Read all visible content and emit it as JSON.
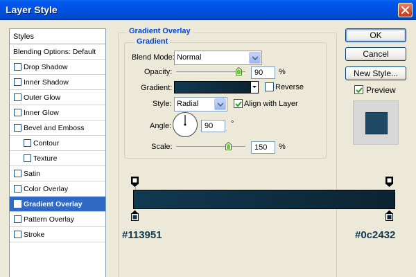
{
  "window": {
    "title": "Layer Style"
  },
  "styles_panel": {
    "header": "Styles",
    "blending_options": "Blending Options: Default",
    "items": [
      {
        "label": "Drop Shadow",
        "checked": false,
        "indent": false,
        "selected": false
      },
      {
        "label": "Inner Shadow",
        "checked": false,
        "indent": false,
        "selected": false
      },
      {
        "label": "Outer Glow",
        "checked": false,
        "indent": false,
        "selected": false
      },
      {
        "label": "Inner Glow",
        "checked": false,
        "indent": false,
        "selected": false
      },
      {
        "label": "Bevel and Emboss",
        "checked": false,
        "indent": false,
        "selected": false
      },
      {
        "label": "Contour",
        "checked": false,
        "indent": true,
        "selected": false
      },
      {
        "label": "Texture",
        "checked": false,
        "indent": true,
        "selected": false
      },
      {
        "label": "Satin",
        "checked": false,
        "indent": false,
        "selected": false
      },
      {
        "label": "Color Overlay",
        "checked": false,
        "indent": false,
        "selected": false
      },
      {
        "label": "Gradient Overlay",
        "checked": true,
        "indent": false,
        "selected": true
      },
      {
        "label": "Pattern Overlay",
        "checked": false,
        "indent": false,
        "selected": false
      },
      {
        "label": "Stroke",
        "checked": false,
        "indent": false,
        "selected": false
      }
    ]
  },
  "gradient_overlay": {
    "section_title": "Gradient Overlay",
    "subsection_title": "Gradient",
    "blend_mode_label": "Blend Mode:",
    "blend_mode_value": "Normal",
    "opacity_label": "Opacity:",
    "opacity_value": "90",
    "opacity_unit": "%",
    "opacity_fraction": 0.9,
    "gradient_label": "Gradient:",
    "reverse_label": "Reverse",
    "reverse_checked": false,
    "style_label": "Style:",
    "style_value": "Radial",
    "align_label": "Align with Layer",
    "align_checked": true,
    "angle_label": "Angle:",
    "angle_value": "90",
    "angle_unit": "°",
    "scale_label": "Scale:",
    "scale_value": "150",
    "scale_unit": "%",
    "scale_fraction": 0.75
  },
  "buttons": {
    "ok": "OK",
    "cancel": "Cancel",
    "new_style": "New Style...",
    "preview_label": "Preview",
    "preview_checked": true
  },
  "gradient_editor": {
    "start_color": "#113951",
    "end_color": "#0c2432",
    "start_label": "#113951",
    "end_label": "#0c2432"
  },
  "colors": {
    "selection": "#316ac5",
    "group_title": "#0046d5",
    "preview_swatch": "#1e4a66"
  },
  "icons": {
    "close": "close-icon",
    "checkmark": "checkmark-icon",
    "dropdown": "chevron-down-icon"
  }
}
